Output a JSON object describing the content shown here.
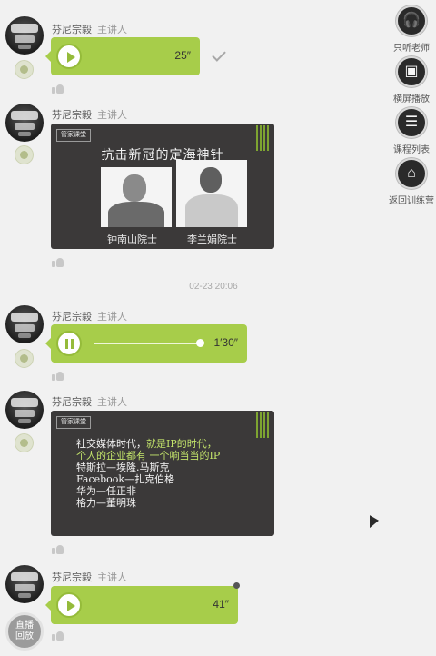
{
  "messages": [
    {
      "sender": "芬尼宗毅",
      "role": "主讲人",
      "type": "voice",
      "duration": "25″",
      "status": "read"
    },
    {
      "sender": "芬尼宗毅",
      "role": "主讲人",
      "type": "slide",
      "slide": {
        "logo": "管家课堂",
        "title": "抗击新冠的定海神针",
        "caption_left": "钟南山院士",
        "caption_right": "李兰娟院士"
      }
    },
    {
      "sender": "芬尼宗毅",
      "role": "主讲人",
      "type": "voice_playing",
      "duration": "1′30″",
      "progress": 0.98
    },
    {
      "sender": "芬尼宗毅",
      "role": "主讲人",
      "type": "slide",
      "slide": {
        "logo": "管家课堂",
        "lines": [
          "社交媒体时代，",
          "就是IP的时代，",
          "个人的企业都有",
          "一个响当当的IP",
          "特斯拉—埃隆.马斯克",
          "Facebook—扎克伯格",
          "华为—任正非",
          "格力—董明珠"
        ]
      }
    },
    {
      "sender": "芬尼宗毅",
      "role": "主讲人",
      "type": "voice",
      "duration": "41″",
      "unread": true
    }
  ],
  "timestamp": "02-23 20:06",
  "side_menu": [
    {
      "label": "只听老师",
      "icon": "headphones-icon",
      "glyph": "🎧"
    },
    {
      "label": "横屏播放",
      "icon": "landscape-icon",
      "glyph": "▣"
    },
    {
      "label": "课程列表",
      "icon": "list-icon",
      "glyph": "☰"
    },
    {
      "label": "返回训练营",
      "icon": "return-icon",
      "glyph": "⌂"
    }
  ],
  "live_button": {
    "line1": "直播",
    "line2": "回放"
  },
  "colors": {
    "voice_bubble": "#a7cd4a",
    "slide_bg": "#3b3939",
    "page_bg": "#f1f1f1",
    "highlight": "#c2e36a"
  }
}
